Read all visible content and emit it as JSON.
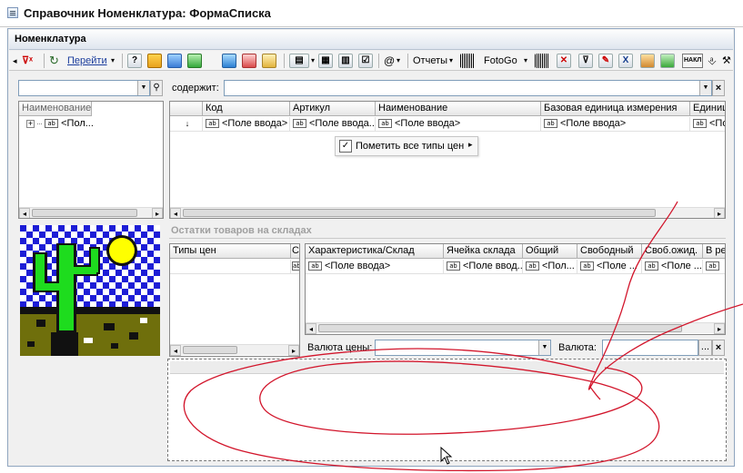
{
  "window": {
    "title": "Справочник Номенклатура: ФормаСписка"
  },
  "form": {
    "header": "Номенклатура"
  },
  "toolbar": {
    "goto_label": "Перейти",
    "help_icon": "?",
    "email_icon": "@",
    "reports_label": "Отчеты",
    "fotogo_label": "FotoGo",
    "naka_label": "НАКЛ"
  },
  "search": {
    "filter_value": "",
    "contains_label": "содержит:",
    "contains_value": ""
  },
  "tree": {
    "header": "Наименование",
    "items": [
      {
        "label": "<Пол..."
      }
    ]
  },
  "main_grid": {
    "columns": [
      "Код",
      "Артикул",
      "Наименование",
      "Базовая единица измерения",
      "Единиц"
    ],
    "row": [
      "<Поле ввода>",
      "<Поле ввода...",
      "<Поле ввода>",
      "<Поле ввода>",
      "<По"
    ]
  },
  "context_menu": {
    "label": "Пометить все типы цен"
  },
  "stock_section": {
    "title": "Остатки товаров на складах"
  },
  "price_types": {
    "header": "Типы цен",
    "header2": "С"
  },
  "stock_grid": {
    "columns": [
      "Характеристика/Склад",
      "Ячейка склада",
      "Общий",
      "Свободный",
      "Своб.ожид.",
      "В ре"
    ],
    "row": [
      "<Поле ввода>",
      "<Поле ввод...",
      "<Пол...",
      "<Поле ...",
      "<Поле ...",
      ""
    ]
  },
  "bottom_fields": {
    "price_currency_label": "Валюта цены:",
    "price_currency_value": "",
    "currency_label": "Валюта:",
    "currency_value": "",
    "ellipsis": "...",
    "clear": "×"
  },
  "icons": [
    "filter-clear-icon",
    "refresh-icon",
    "help-icon",
    "cactus-picture"
  ],
  "colors": {
    "accent": "#7f9db9",
    "section_title": "#a0a0a0",
    "annotation": "#d2152b"
  }
}
